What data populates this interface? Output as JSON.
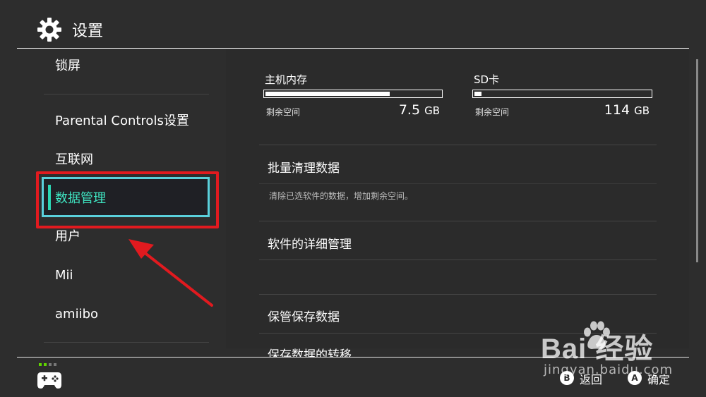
{
  "header": {
    "title": "设置",
    "icon": "gear-icon"
  },
  "sidebar": {
    "items": [
      {
        "label": "锁屏"
      },
      {
        "label": "Parental Controls设置"
      },
      {
        "label": "互联网"
      },
      {
        "label": "数据管理",
        "selected": true
      },
      {
        "label": "用户"
      },
      {
        "label": "Mii"
      },
      {
        "label": "amiibo"
      }
    ]
  },
  "storage": {
    "system": {
      "title": "主机内存",
      "remain_label": "剩余空间",
      "remain_value": "7.5",
      "unit": "GB",
      "used_fraction": 0.71
    },
    "sd": {
      "title": "SD卡",
      "remain_label": "剩余空间",
      "remain_value": "114",
      "unit": "GB",
      "used_fraction": 0.04
    }
  },
  "menu": {
    "items": [
      {
        "label": "批量清理数据",
        "desc": "清除已选软件的数据，增加剩余空间。"
      },
      {
        "label": "软件的详细管理"
      },
      {
        "label": "保管保存数据"
      },
      {
        "label": "保存数据的转移"
      }
    ]
  },
  "footer": {
    "back_label": "返回",
    "back_button": "B",
    "ok_label": "确定",
    "ok_button": "A"
  },
  "watermark": {
    "logo": "Bai  经验",
    "url": "jingyan.baidu.com"
  },
  "colors": {
    "accent": "#3fe5c2",
    "selection_border": "#5ad0dc",
    "annotation_red": "#e11a1f"
  }
}
